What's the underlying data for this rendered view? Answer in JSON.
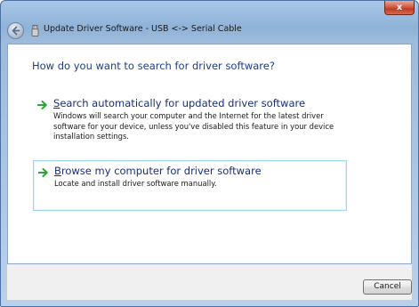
{
  "window": {
    "title": "Update Driver Software - USB <-> Serial Cable",
    "close_label": "x"
  },
  "main": {
    "heading": "How do you want to search for driver software?",
    "options": [
      {
        "title_accel": "S",
        "title_rest": "earch automatically for updated driver software",
        "description": "Windows will search your computer and the Internet for the latest driver software for your device, unless you've disabled this feature in your device installation settings.",
        "icon": "green-arrow-icon"
      },
      {
        "title_accel": "B",
        "title_rest": "rowse my computer for driver software",
        "description": "Locate and install driver software manually.",
        "icon": "green-arrow-icon"
      }
    ]
  },
  "footer": {
    "cancel_label": "Cancel"
  },
  "colors": {
    "heading": "#1e3d8a",
    "option_title": "#1a2f7a",
    "arrow": "#2ea43a",
    "hover_border": "#9fd7ee"
  }
}
